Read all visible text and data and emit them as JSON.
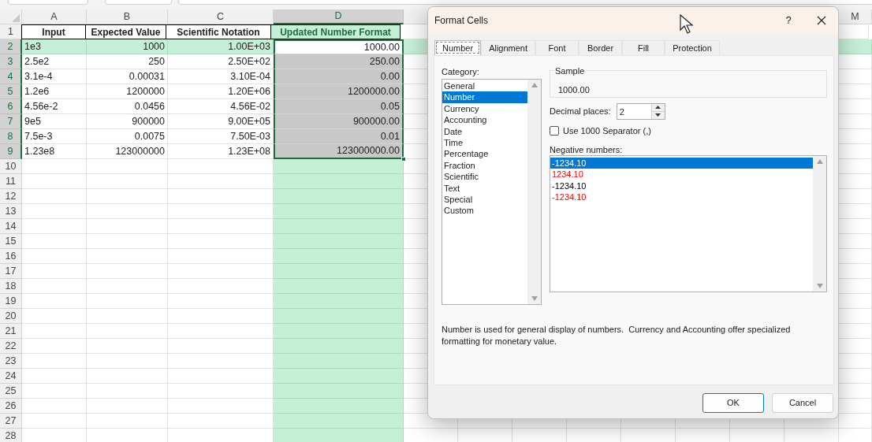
{
  "sheet": {
    "columns": [
      {
        "label": "A",
        "selected": false
      },
      {
        "label": "B",
        "selected": false
      },
      {
        "label": "C",
        "selected": false
      },
      {
        "label": "D",
        "selected": true
      },
      {
        "label": "M",
        "selected": false
      }
    ],
    "rows": [
      {
        "number": "1",
        "kind": "header",
        "selected": false,
        "highlighted": false,
        "cells": [
          {
            "text": "Input"
          },
          {
            "text": "Expected Value"
          },
          {
            "text": "Scientific Notation"
          },
          {
            "text": "Updated Number Format"
          }
        ]
      },
      {
        "number": "2",
        "kind": "data",
        "selected": true,
        "highlighted": true,
        "cells": [
          {
            "text": "1e3"
          },
          {
            "text": "1000"
          },
          {
            "text": "1.00E+03"
          },
          {
            "text": "1000.00",
            "active": true
          }
        ]
      },
      {
        "number": "3",
        "kind": "data",
        "selected": true,
        "highlighted": false,
        "cells": [
          {
            "text": "2.5e2"
          },
          {
            "text": "250"
          },
          {
            "text": "2.50E+02"
          },
          {
            "text": "250.00",
            "shaded": true
          }
        ]
      },
      {
        "number": "4",
        "kind": "data",
        "selected": true,
        "highlighted": false,
        "cells": [
          {
            "text": "3.1e-4"
          },
          {
            "text": "0.00031"
          },
          {
            "text": "3.10E-04"
          },
          {
            "text": "0.00",
            "shaded": true
          }
        ]
      },
      {
        "number": "5",
        "kind": "data",
        "selected": true,
        "highlighted": false,
        "cells": [
          {
            "text": "1.2e6"
          },
          {
            "text": "1200000"
          },
          {
            "text": "1.20E+06"
          },
          {
            "text": "1200000.00",
            "shaded": true
          }
        ]
      },
      {
        "number": "6",
        "kind": "data",
        "selected": true,
        "highlighted": false,
        "cells": [
          {
            "text": "4.56e-2"
          },
          {
            "text": "0.0456"
          },
          {
            "text": "4.56E-02"
          },
          {
            "text": "0.05",
            "shaded": true
          }
        ]
      },
      {
        "number": "7",
        "kind": "data",
        "selected": true,
        "highlighted": false,
        "cells": [
          {
            "text": "9e5"
          },
          {
            "text": "900000"
          },
          {
            "text": "9.00E+05"
          },
          {
            "text": "900000.00",
            "shaded": true
          }
        ]
      },
      {
        "number": "8",
        "kind": "data",
        "selected": true,
        "highlighted": false,
        "cells": [
          {
            "text": "7.5e-3"
          },
          {
            "text": "0.0075"
          },
          {
            "text": "7.50E-03"
          },
          {
            "text": "0.01",
            "shaded": true
          }
        ]
      },
      {
        "number": "9",
        "kind": "data",
        "selected": true,
        "highlighted": false,
        "cells": [
          {
            "text": "1.23e8"
          },
          {
            "text": "123000000"
          },
          {
            "text": "1.23E+08"
          },
          {
            "text": "123000000.00",
            "shaded": true
          }
        ]
      },
      {
        "number": "10",
        "kind": "data",
        "selected": false,
        "highlighted": false
      },
      {
        "number": "11",
        "kind": "data",
        "selected": false,
        "highlighted": false
      },
      {
        "number": "12",
        "kind": "data",
        "selected": false,
        "highlighted": false
      },
      {
        "number": "13",
        "kind": "data",
        "selected": false,
        "highlighted": false
      },
      {
        "number": "14",
        "kind": "data",
        "selected": false,
        "highlighted": false
      },
      {
        "number": "15",
        "kind": "data",
        "selected": false,
        "highlighted": false
      },
      {
        "number": "16",
        "kind": "data",
        "selected": false,
        "highlighted": false
      },
      {
        "number": "17",
        "kind": "data",
        "selected": false,
        "highlighted": false
      },
      {
        "number": "18",
        "kind": "data",
        "selected": false,
        "highlighted": false
      },
      {
        "number": "19",
        "kind": "data",
        "selected": false,
        "highlighted": false
      },
      {
        "number": "20",
        "kind": "data",
        "selected": false,
        "highlighted": false
      },
      {
        "number": "21",
        "kind": "data",
        "selected": false,
        "highlighted": false
      },
      {
        "number": "22",
        "kind": "data",
        "selected": false,
        "highlighted": false
      },
      {
        "number": "23",
        "kind": "data",
        "selected": false,
        "highlighted": false
      },
      {
        "number": "24",
        "kind": "data",
        "selected": false,
        "highlighted": false
      },
      {
        "number": "25",
        "kind": "data",
        "selected": false,
        "highlighted": false
      },
      {
        "number": "26",
        "kind": "data",
        "selected": false,
        "highlighted": false
      },
      {
        "number": "27",
        "kind": "data",
        "selected": false,
        "highlighted": false
      },
      {
        "number": "28",
        "kind": "data",
        "selected": false,
        "highlighted": false
      }
    ]
  },
  "dialog": {
    "title": "Format Cells",
    "help": "?",
    "tabs": [
      {
        "label": "Number",
        "selected": true
      },
      {
        "label": "Alignment",
        "selected": false
      },
      {
        "label": "Font",
        "selected": false
      },
      {
        "label": "Border",
        "selected": false
      },
      {
        "label": "Fill",
        "selected": false
      },
      {
        "label": "Protection",
        "selected": false
      }
    ],
    "category_label": "Category:",
    "categories": [
      {
        "label": "General",
        "selected": false
      },
      {
        "label": "Number",
        "selected": true
      },
      {
        "label": "Currency",
        "selected": false
      },
      {
        "label": "Accounting",
        "selected": false
      },
      {
        "label": "Date",
        "selected": false
      },
      {
        "label": "Time",
        "selected": false
      },
      {
        "label": "Percentage",
        "selected": false
      },
      {
        "label": "Fraction",
        "selected": false
      },
      {
        "label": "Scientific",
        "selected": false
      },
      {
        "label": "Text",
        "selected": false
      },
      {
        "label": "Special",
        "selected": false
      },
      {
        "label": "Custom",
        "selected": false
      }
    ],
    "sample": {
      "label": "Sample",
      "value": "1000.00"
    },
    "decimal_places": {
      "label": "Decimal places:",
      "value": "2"
    },
    "separator": {
      "label": "Use 1000 Separator (,)",
      "checked": false
    },
    "negative_label": "Negative numbers:",
    "negative_numbers": [
      {
        "label": "-1234.10",
        "selected": true
      },
      {
        "label": "1234.10",
        "selected": false,
        "color": "#ff0000"
      },
      {
        "label": "-1234.10",
        "selected": false,
        "color": "#000000"
      },
      {
        "label": "-1234.10",
        "selected": false,
        "color": "#ff0000"
      }
    ],
    "description": "Number is used for general display of numbers.  Currency and Accounting offer specialized formatting for monetary value.",
    "buttons": [
      {
        "label": "OK",
        "default": true
      },
      {
        "label": "Cancel",
        "default": false
      }
    ]
  }
}
